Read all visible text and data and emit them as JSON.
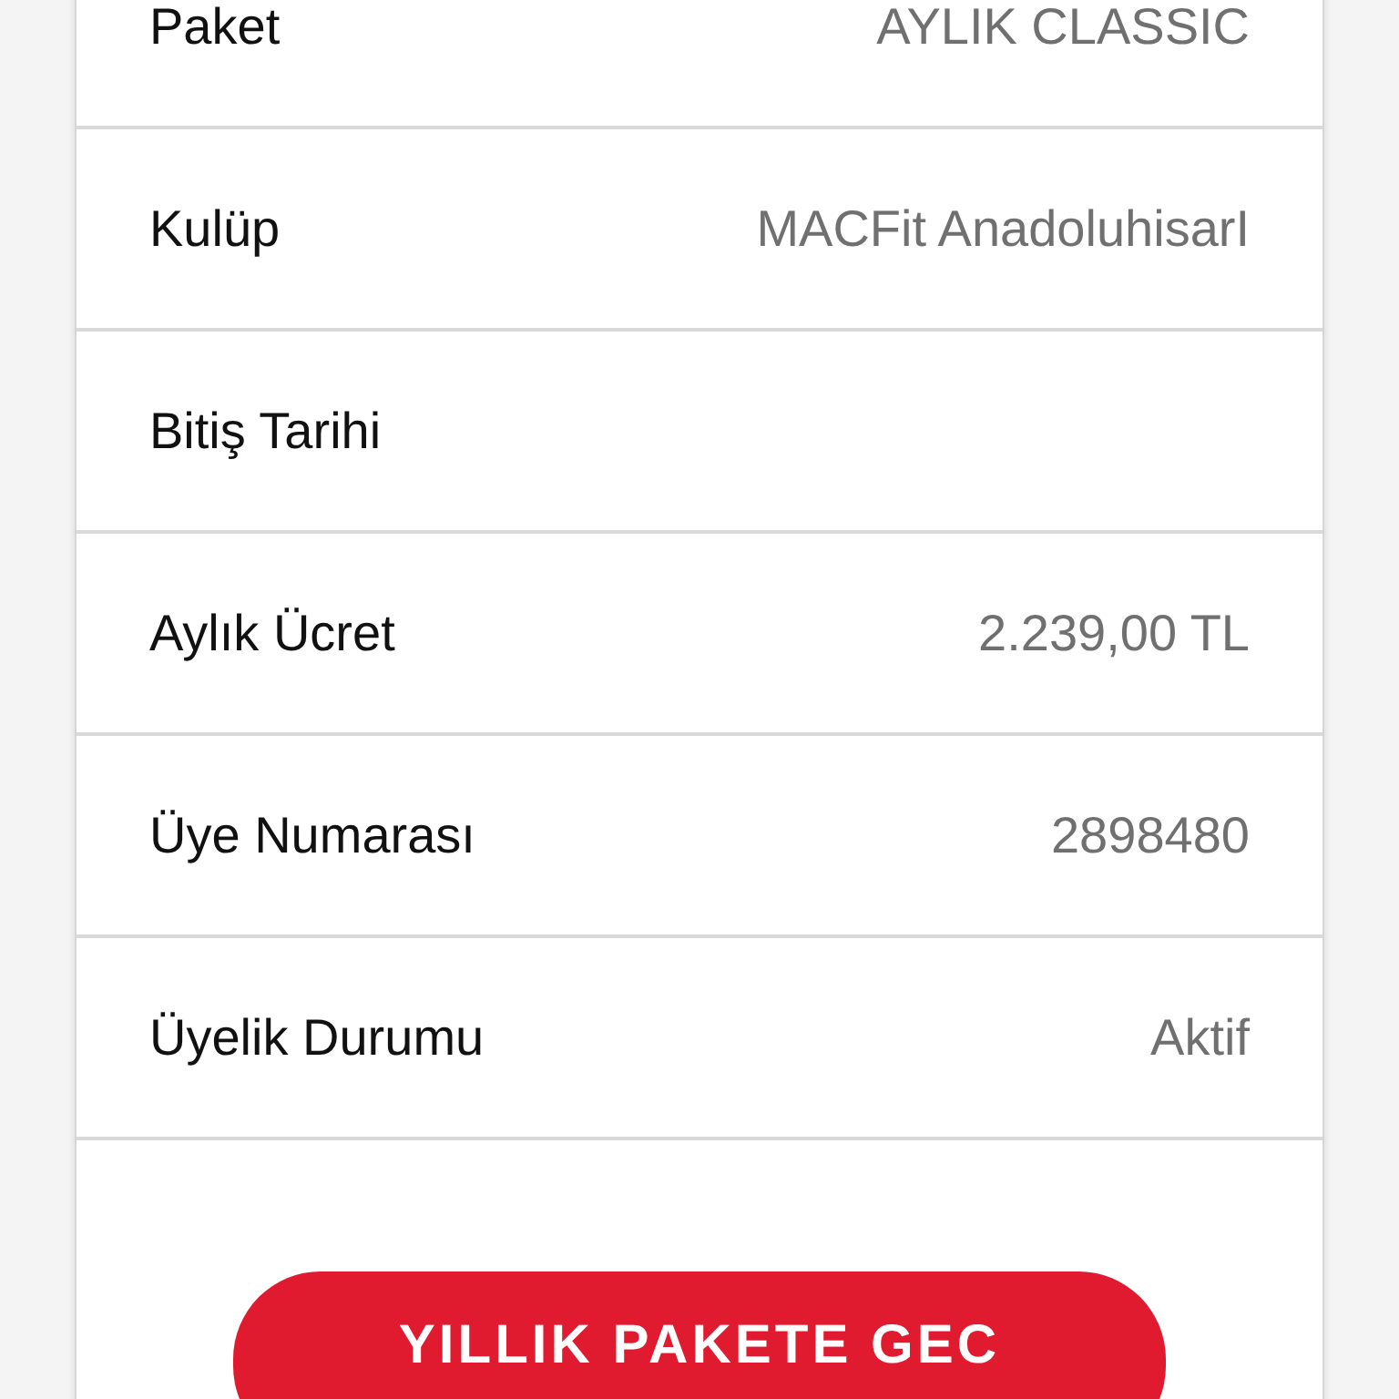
{
  "details": [
    {
      "label": "Paket",
      "value": "AYLIK CLASSIC"
    },
    {
      "label": "Kulüp",
      "value": "MACFit AnadoluhisarI"
    },
    {
      "label": "Bitiş Tarihi"
    },
    {
      "label": "Aylık Ücret",
      "value": "2.239,00 TL"
    },
    {
      "label": "Üye Numarası",
      "value": "2898480"
    },
    {
      "label": "Üyelik Durumu",
      "value": "Aktif"
    }
  ],
  "button": "YILLIK PAKETE GEC"
}
